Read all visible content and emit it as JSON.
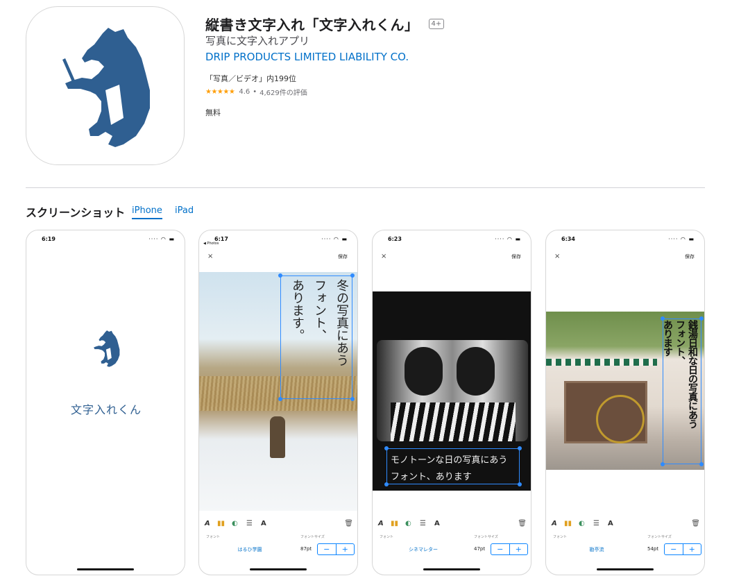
{
  "app": {
    "title": "縦書き文字入れ「文字入れくん」",
    "age_rating": "4+",
    "subtitle": "写真に文字入れアプリ",
    "developer": "DRIP PRODUCTS LIMITED LIABILITY CO.",
    "rank": "「写真／ビデオ」内199位",
    "stars": "★★★★★",
    "rating": "4.6",
    "rating_count": "4,629件の評価",
    "price": "無料",
    "icon": "bear-icon",
    "icon_color": "#2f5f91"
  },
  "screenshots": {
    "title": "スクリーンショット",
    "tabs": [
      "iPhone",
      "iPad"
    ],
    "phones": [
      {
        "time": "6:19",
        "splash_text": "文字入れくん"
      },
      {
        "time": "6:17",
        "back_label": "◀ Photos",
        "save": "保存",
        "close": "×",
        "vertical_text_lines": [
          "冬の写真にあう",
          "フォント、",
          "あります。"
        ],
        "font_label": "フォント",
        "font_name": "はるひ学園",
        "size_label": "フォントサイズ",
        "size_value": "87pt"
      },
      {
        "time": "6:23",
        "save": "保存",
        "close": "×",
        "caption_lines": [
          "モノトーンな日の写真にあう",
          "フォント、あります"
        ],
        "font_label": "フォント",
        "font_name": "シネマレター",
        "size_label": "フォントサイズ",
        "size_value": "47pt"
      },
      {
        "time": "6:34",
        "save": "保存",
        "close": "×",
        "vertical_text_lines": [
          "銭湯日和な日の写真にあう",
          "フォント、",
          "あります"
        ],
        "font_label": "フォント",
        "font_name": "勘亭流",
        "size_label": "フォントサイズ",
        "size_value": "54pt"
      }
    ],
    "stepper": {
      "minus": "−",
      "plus": "+"
    },
    "toolbar_icons": [
      "font-icon",
      "color-palette-icon",
      "shadow-icon",
      "line-spacing-icon",
      "outline-icon",
      "trash-icon"
    ],
    "toolbar_glyphs": {
      "font": "A",
      "color": "▮▮",
      "shadow": "◐",
      "spacing": "☰",
      "outline": "A",
      "trash": "🗑"
    },
    "status_glyphs": "···· ◠ ▬",
    "accent_color": "#0070c9"
  }
}
